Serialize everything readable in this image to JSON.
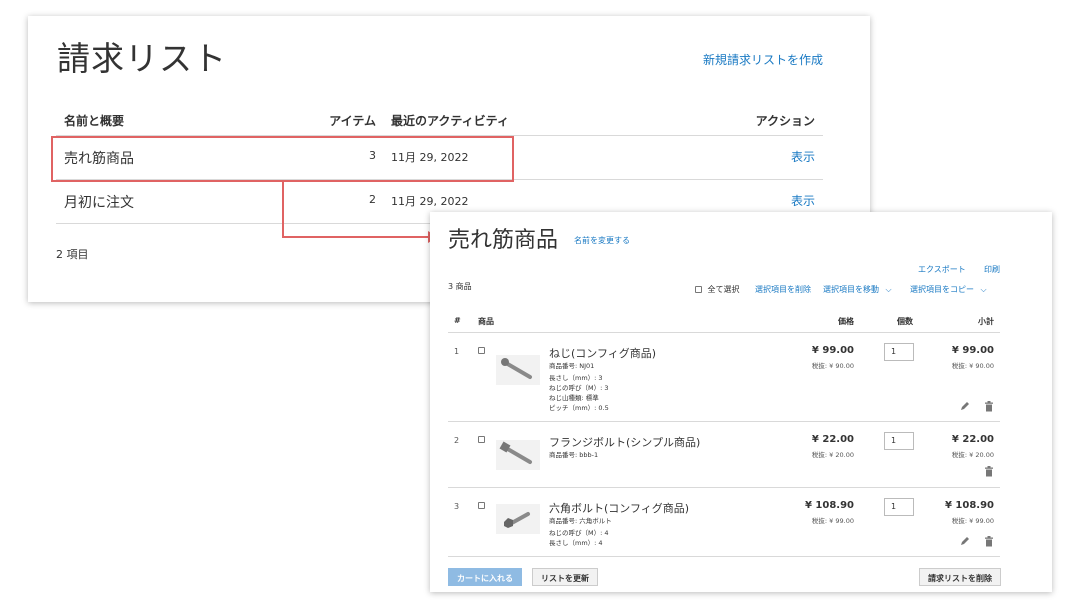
{
  "requisition_lists": {
    "title": "請求リスト",
    "create_link": "新規請求リストを作成",
    "headers": {
      "name": "名前と概要",
      "items": "アイテム",
      "activity": "最近のアクティビティ",
      "action": "アクション"
    },
    "rows": [
      {
        "name": "売れ筋商品",
        "items": "3",
        "date": "11月 29, 2022",
        "action": "表示"
      },
      {
        "name": "月初に注文",
        "items": "2",
        "date": "11月 29, 2022",
        "action": "表示"
      }
    ],
    "count": "2 項目"
  },
  "list_detail": {
    "title": "売れ筋商品",
    "rename_link": "名前を変更する",
    "export_link": "エクスポート",
    "print_link": "印刷",
    "product_count": "3 商品",
    "toolbar": {
      "select_all": "全て選択",
      "delete_selected": "選択項目を削除",
      "move_selected": "選択項目を移動",
      "copy_selected": "選択項目をコピー"
    },
    "headers": {
      "num": "#",
      "product": "商品",
      "price": "価格",
      "qty": "個数",
      "subtotal": "小計"
    },
    "products": [
      {
        "num": "1",
        "name": "ねじ(コンフィグ商品)",
        "sku": "商品番号: NJ01",
        "options": [
          "長さし（mm）: 3",
          "ねじの呼び（M）: 3",
          "ねじ山種類: 標準",
          "ピッチ（mm）: 0.5"
        ],
        "price": "¥ 99.00",
        "price_ex": "税抜: ¥ 90.00",
        "qty": "1",
        "subtotal": "¥ 99.00",
        "subtotal_ex": "税抜: ¥ 90.00"
      },
      {
        "num": "2",
        "name": "フランジボルト(シンプル商品)",
        "sku": "商品番号: bbb-1",
        "options": [],
        "price": "¥ 22.00",
        "price_ex": "税抜: ¥ 20.00",
        "qty": "1",
        "subtotal": "¥ 22.00",
        "subtotal_ex": "税抜: ¥ 20.00"
      },
      {
        "num": "3",
        "name": "六角ボルト(コンフィグ商品)",
        "sku": "商品番号: 六角ボルト",
        "options": [
          "ねじの呼び（M）: 4",
          "長さし（mm）: 4"
        ],
        "price": "¥ 108.90",
        "price_ex": "税抜: ¥ 99.00",
        "qty": "1",
        "subtotal": "¥ 108.90",
        "subtotal_ex": "税抜: ¥ 99.00"
      }
    ],
    "buttons": {
      "add_to_cart": "カートに入れる",
      "update_list": "リストを更新",
      "delete_list": "請求リストを削除"
    }
  },
  "colors": {
    "link": "#1979c3",
    "highlight": "#e06363",
    "cart_button": "#8fbbe3"
  }
}
